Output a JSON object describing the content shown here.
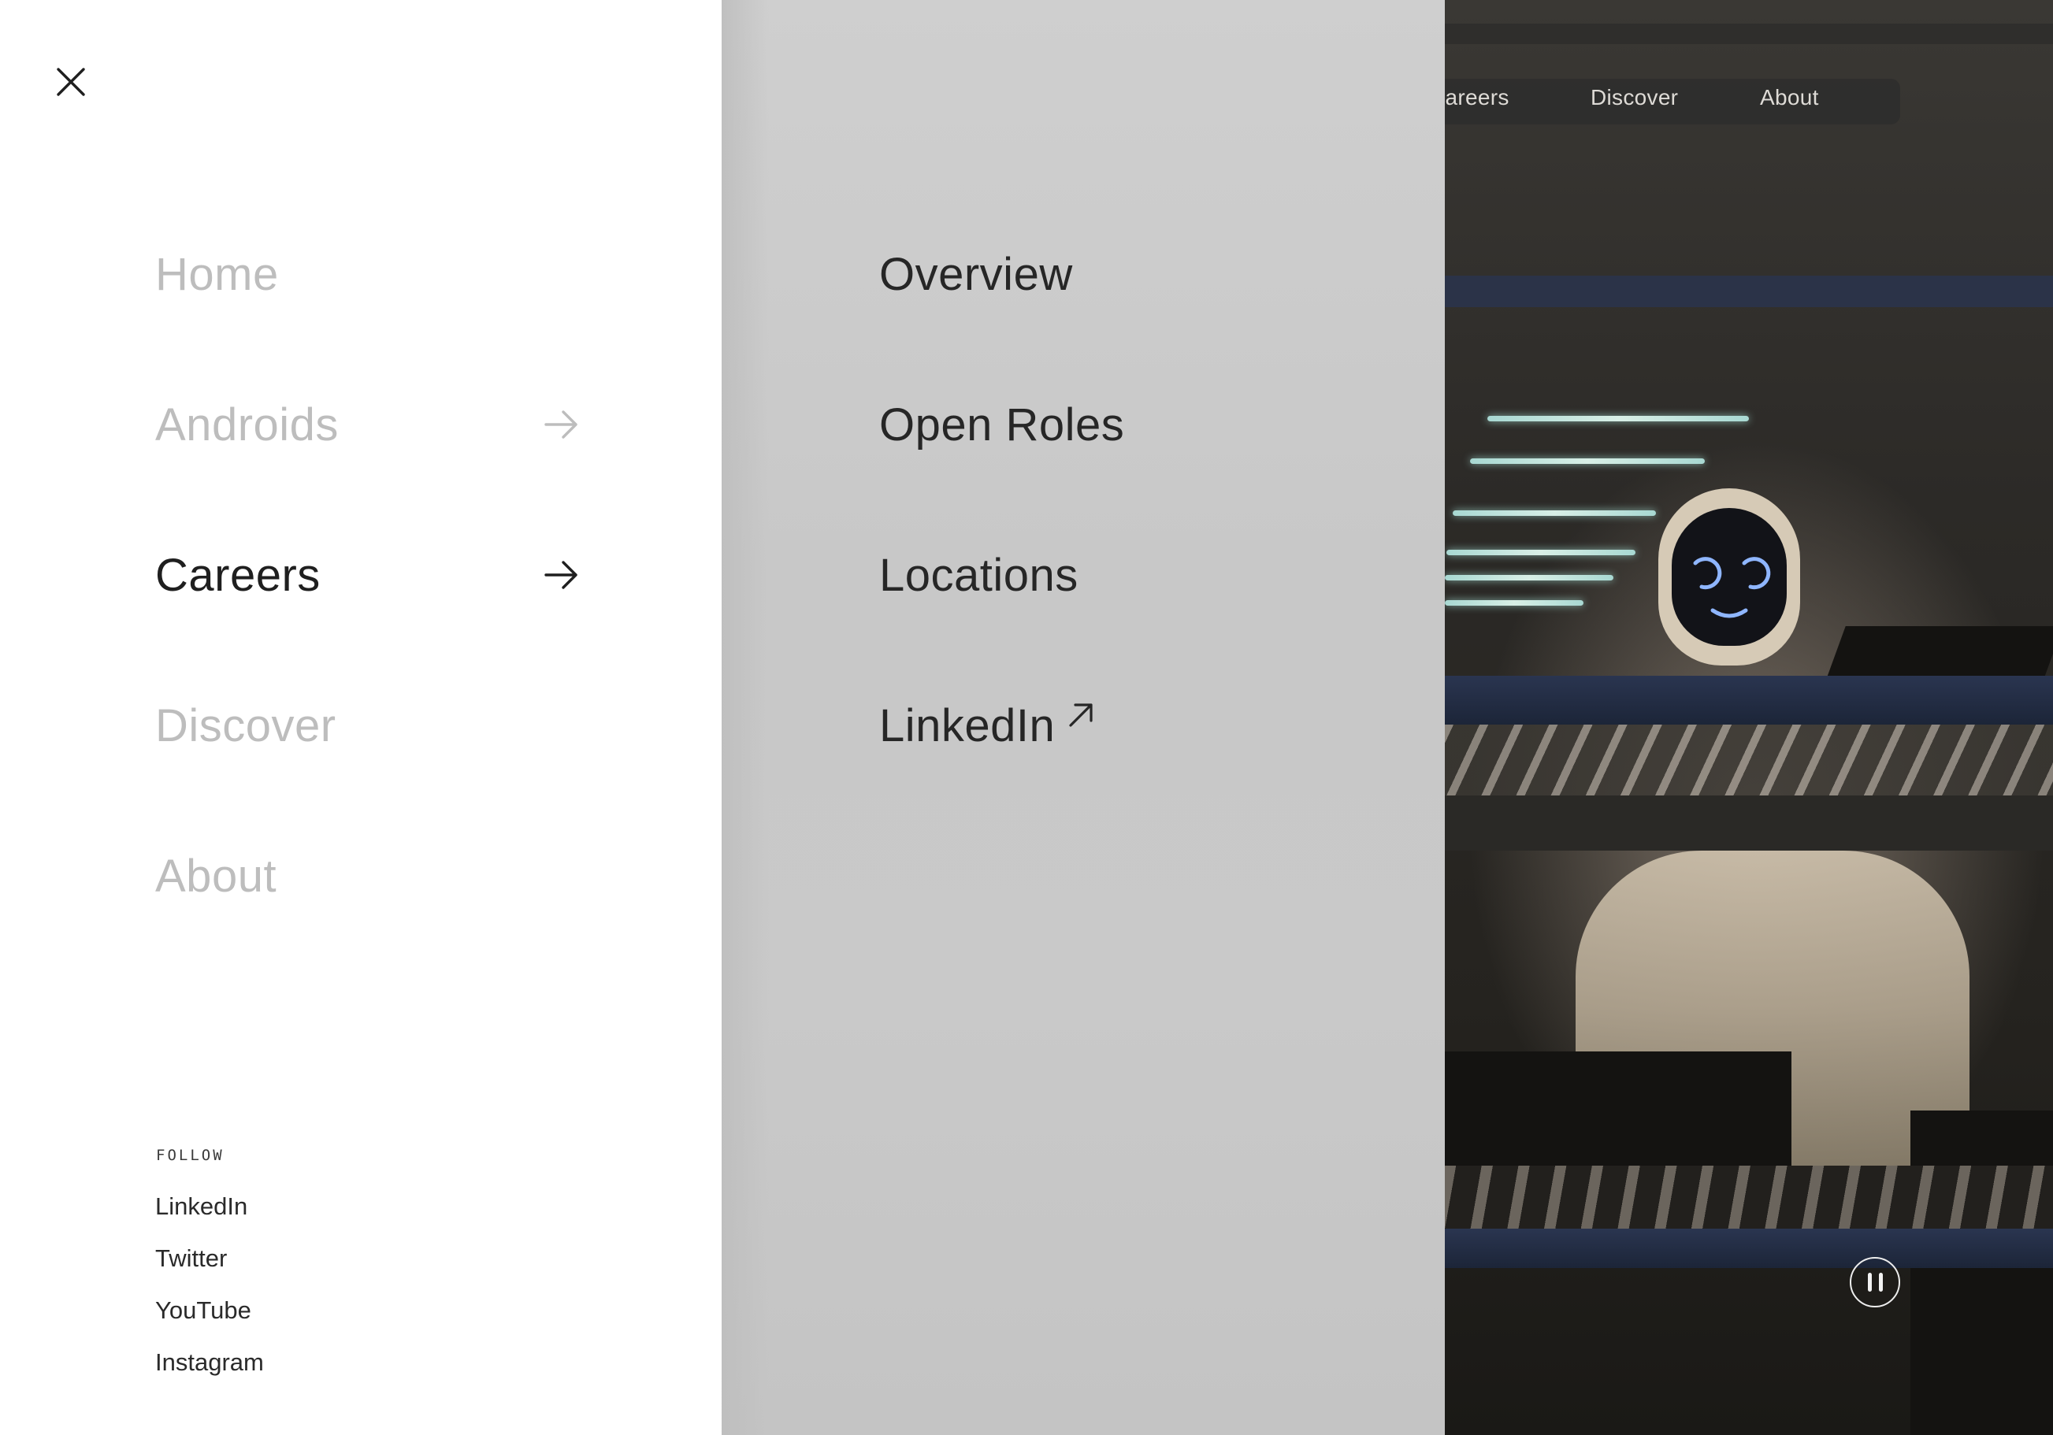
{
  "close_icon": "close-icon",
  "primary_nav": {
    "items": [
      {
        "label": "Home",
        "state": "inactive",
        "has_arrow": false
      },
      {
        "label": "Androids",
        "state": "inactive",
        "has_arrow": true
      },
      {
        "label": "Careers",
        "state": "active",
        "has_arrow": true
      },
      {
        "label": "Discover",
        "state": "inactive",
        "has_arrow": false
      },
      {
        "label": "About",
        "state": "inactive",
        "has_arrow": false
      }
    ]
  },
  "submenu": {
    "parent": "Careers",
    "items": [
      {
        "label": "Overview",
        "external": false
      },
      {
        "label": "Open Roles",
        "external": false
      },
      {
        "label": "Locations",
        "external": false
      },
      {
        "label": "LinkedIn",
        "external": true,
        "icon": "external-arrow-icon"
      }
    ]
  },
  "follow": {
    "heading": "FOLLOW",
    "links": [
      {
        "label": "LinkedIn"
      },
      {
        "label": "Twitter"
      },
      {
        "label": "YouTube"
      },
      {
        "label": "Instagram"
      }
    ]
  },
  "top_nav": {
    "items": [
      {
        "label": "Careers"
      },
      {
        "label": "Discover"
      },
      {
        "label": "About"
      }
    ]
  },
  "video": {
    "control_icon": "pause-icon"
  },
  "colors": {
    "menu_background": "#ffffff",
    "active_text": "#1f1f1f",
    "inactive_text": "#bdbdbd",
    "frosted_panel": "#c9c9c9"
  }
}
